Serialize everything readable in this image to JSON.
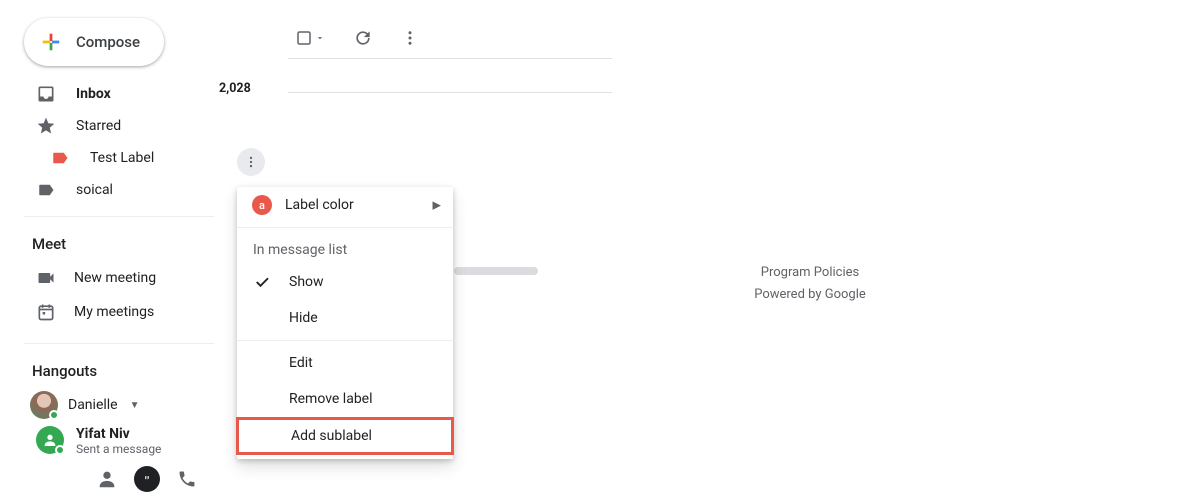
{
  "compose": {
    "label": "Compose"
  },
  "toolbar": {
    "select_all": "select-all",
    "refresh": "refresh",
    "more": "more"
  },
  "nav": {
    "inbox": {
      "label": "Inbox",
      "count": "2,028"
    },
    "starred": {
      "label": "Starred"
    },
    "test_label": {
      "label": "Test Label"
    },
    "soical": {
      "label": "soical"
    }
  },
  "meet": {
    "title": "Meet",
    "new_meeting": "New meeting",
    "my_meetings": "My meetings"
  },
  "hangouts": {
    "title": "Hangouts",
    "user_name": "Danielle",
    "chat_name": "Yifat Niv",
    "chat_subtitle": "Sent a message"
  },
  "context_menu": {
    "label_color": "Label color",
    "swatch_letter": "a",
    "section_label": "In message list",
    "show": "Show",
    "hide": "Hide",
    "edit": "Edit",
    "remove": "Remove label",
    "add_sublabel": "Add sublabel"
  },
  "footer": {
    "policies": "Program Policies",
    "powered": "Powered by Google"
  }
}
